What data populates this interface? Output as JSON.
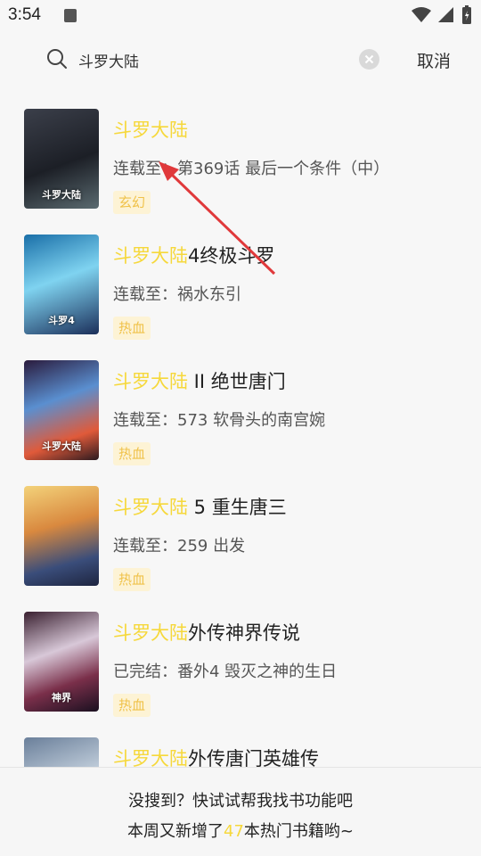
{
  "status": {
    "time": "3:54"
  },
  "search": {
    "value": "斗罗大陆",
    "placeholder": "",
    "cancel_label": "取消"
  },
  "highlight_color": "#f6d83b",
  "results": [
    {
      "title_highlight": "斗罗大陆",
      "title_rest": "",
      "status_prefix": "连载至：",
      "status_text": "第369话 最后一个条件（中）",
      "tag": "玄幻",
      "cover_text": "斗罗大陆"
    },
    {
      "title_highlight": "斗罗大陆",
      "title_rest": "4终极斗罗",
      "status_prefix": "连载至：",
      "status_text": "祸水东引",
      "tag": "热血",
      "cover_text": "斗罗4"
    },
    {
      "title_highlight": "斗罗大陆",
      "title_rest": " II 绝世唐门",
      "status_prefix": "连载至：",
      "status_text": "573  软骨头的南宫婉",
      "tag": "热血",
      "cover_text": "斗罗大陆"
    },
    {
      "title_highlight": "斗罗大陆",
      "title_rest": " 5 重生唐三",
      "status_prefix": "连载至：",
      "status_text": "259  出发",
      "tag": "热血",
      "cover_text": ""
    },
    {
      "title_highlight": "斗罗大陆",
      "title_rest": "外传神界传说",
      "status_prefix": "已完结：",
      "status_text": "番外4  毁灭之神的生日",
      "tag": "热血",
      "cover_text": "神界"
    },
    {
      "title_highlight": "斗罗大陆",
      "title_rest": "外传唐门英雄传",
      "status_prefix": "",
      "status_text": "",
      "tag": "",
      "cover_text": ""
    }
  ],
  "footer": {
    "line1": "没搜到？快试试帮我找书功能吧",
    "line2_before": "本周又新增了",
    "line2_number": "47",
    "line2_after": "本热门书籍哟~"
  }
}
